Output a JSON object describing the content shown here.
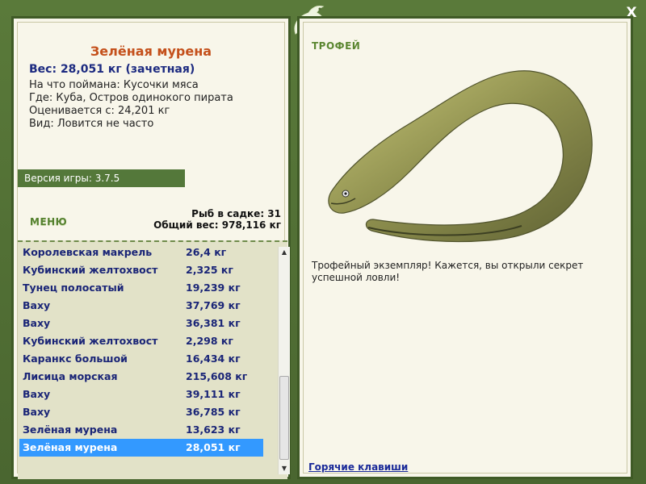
{
  "window": {
    "close_label": "X"
  },
  "fish": {
    "title": "Зелёная мурена",
    "weight": "Вес: 28,051 кг (зачетная)",
    "bait": "На что поймана: Кусочки мяса",
    "place": "Где: Куба, Остров одинокого пирата",
    "estimated": "Оценивается с: 24,201 кг",
    "kind": "Вид: Ловится не часто"
  },
  "version": "Версия игры: 3.7.5",
  "menu_label": "МЕНЮ",
  "stats": {
    "count": "Рыб в садке: 31",
    "total": "Общий вес: 978,116 кг"
  },
  "catch_list": [
    {
      "name": "Королевская макрель",
      "weight": "26,4 кг"
    },
    {
      "name": "Кубинский желтохвост",
      "weight": "2,325 кг"
    },
    {
      "name": "Тунец полосатый",
      "weight": "19,239 кг"
    },
    {
      "name": "Ваху",
      "weight": "37,769 кг"
    },
    {
      "name": "Ваху",
      "weight": "36,381 кг"
    },
    {
      "name": "Кубинский желтохвост",
      "weight": "2,298 кг"
    },
    {
      "name": "Каранкс большой",
      "weight": "16,434 кг"
    },
    {
      "name": "Лисица морская",
      "weight": "215,608 кг"
    },
    {
      "name": "Ваху",
      "weight": "39,111 кг"
    },
    {
      "name": "Ваху",
      "weight": "36,785 кг"
    },
    {
      "name": "Зелёная мурена",
      "weight": "13,623 кг"
    },
    {
      "name": "Зелёная мурена",
      "weight": "28,051 кг"
    }
  ],
  "selected_index": 11,
  "trophy_label": "ТРОФЕЙ",
  "description": "Трофейный экземпляр! Кажется, вы открыли секрет успешной ловли!",
  "hotkeys_label": "Горячие клавиши",
  "colors": {
    "selection": "#3399ff",
    "accent_green": "#54783a",
    "title_orange": "#c4501b",
    "text_navy": "#1a2577"
  },
  "icons": {
    "logo": "lizard-logo-icon",
    "eel_image": "green-moray-eel"
  }
}
